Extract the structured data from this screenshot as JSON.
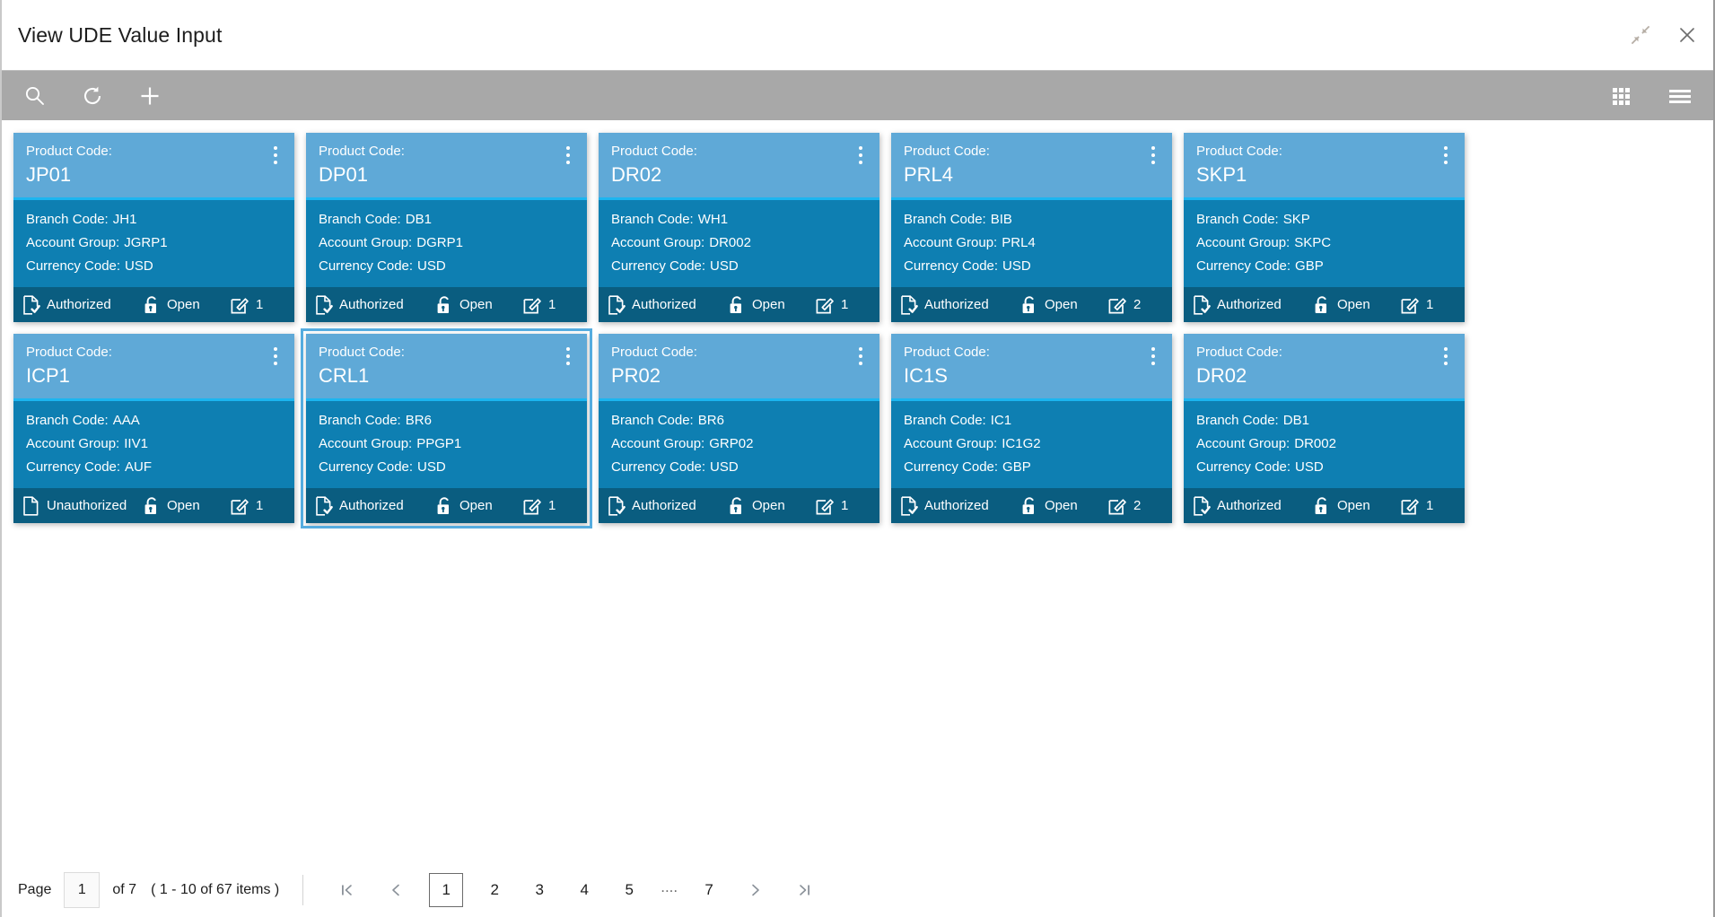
{
  "window": {
    "title": "View UDE Value Input",
    "collapse_icon": "collapse-arrows-icon",
    "close_icon": "close-icon"
  },
  "toolbar": {
    "search_icon": "search-icon",
    "refresh_icon": "refresh-icon",
    "add_icon": "plus-icon",
    "tile_view_icon": "grid-view-icon",
    "menu_icon": "hamburger-menu-icon"
  },
  "card_labels": {
    "product_code": "Product Code:",
    "branch_code": "Branch Code:",
    "account_group": "Account Group:",
    "currency_code": "Currency Code:",
    "kebab": "more-options"
  },
  "cards": [
    {
      "product_code": "JP01",
      "branch_code": "JH1",
      "account_group": "JGRP1",
      "currency_code": "USD",
      "auth_status": "Authorized",
      "lock_status": "Open",
      "mod_count": "1",
      "selected": false
    },
    {
      "product_code": "DP01",
      "branch_code": "DB1",
      "account_group": "DGRP1",
      "currency_code": "USD",
      "auth_status": "Authorized",
      "lock_status": "Open",
      "mod_count": "1",
      "selected": false
    },
    {
      "product_code": "DR02",
      "branch_code": "WH1",
      "account_group": "DR002",
      "currency_code": "USD",
      "auth_status": "Authorized",
      "lock_status": "Open",
      "mod_count": "1",
      "selected": false
    },
    {
      "product_code": "PRL4",
      "branch_code": "BIB",
      "account_group": "PRL4",
      "currency_code": "USD",
      "auth_status": "Authorized",
      "lock_status": "Open",
      "mod_count": "2",
      "selected": false
    },
    {
      "product_code": "SKP1",
      "branch_code": "SKP",
      "account_group": "SKPC",
      "currency_code": "GBP",
      "auth_status": "Authorized",
      "lock_status": "Open",
      "mod_count": "1",
      "selected": false
    },
    {
      "product_code": "ICP1",
      "branch_code": "AAA",
      "account_group": "IIV1",
      "currency_code": "AUF",
      "auth_status": "Unauthorized",
      "lock_status": "Open",
      "mod_count": "1",
      "selected": false
    },
    {
      "product_code": "CRL1",
      "branch_code": "BR6",
      "account_group": "PPGP1",
      "currency_code": "USD",
      "auth_status": "Authorized",
      "lock_status": "Open",
      "mod_count": "1",
      "selected": true
    },
    {
      "product_code": "PR02",
      "branch_code": "BR6",
      "account_group": "GRP02",
      "currency_code": "USD",
      "auth_status": "Authorized",
      "lock_status": "Open",
      "mod_count": "1",
      "selected": false
    },
    {
      "product_code": "IC1S",
      "branch_code": "IC1",
      "account_group": "IC1G2",
      "currency_code": "GBP",
      "auth_status": "Authorized",
      "lock_status": "Open",
      "mod_count": "2",
      "selected": false
    },
    {
      "product_code": "DR02",
      "branch_code": "DB1",
      "account_group": "DR002",
      "currency_code": "USD",
      "auth_status": "Authorized",
      "lock_status": "Open",
      "mod_count": "1",
      "selected": false
    }
  ],
  "pagination": {
    "page_label": "Page",
    "page_value": "1",
    "of_label": "of 7",
    "items_label": "( 1 - 10 of 67 items )",
    "first_icon": "first-page-icon",
    "prev_icon": "previous-page-icon",
    "next_icon": "next-page-icon",
    "last_icon": "last-page-icon",
    "pages": [
      "1",
      "2",
      "3",
      "4",
      "5"
    ],
    "ellipsis": "....",
    "last_page": "7",
    "active_page": "1"
  },
  "colors": {
    "card_header": "#5fa9d7",
    "card_body": "#0e7fb2",
    "card_footer": "#0a5d80",
    "accent_divider": "#1cb5f0",
    "toolbar_bg": "#a8a8a8",
    "selection_outline": "#55acdf"
  }
}
